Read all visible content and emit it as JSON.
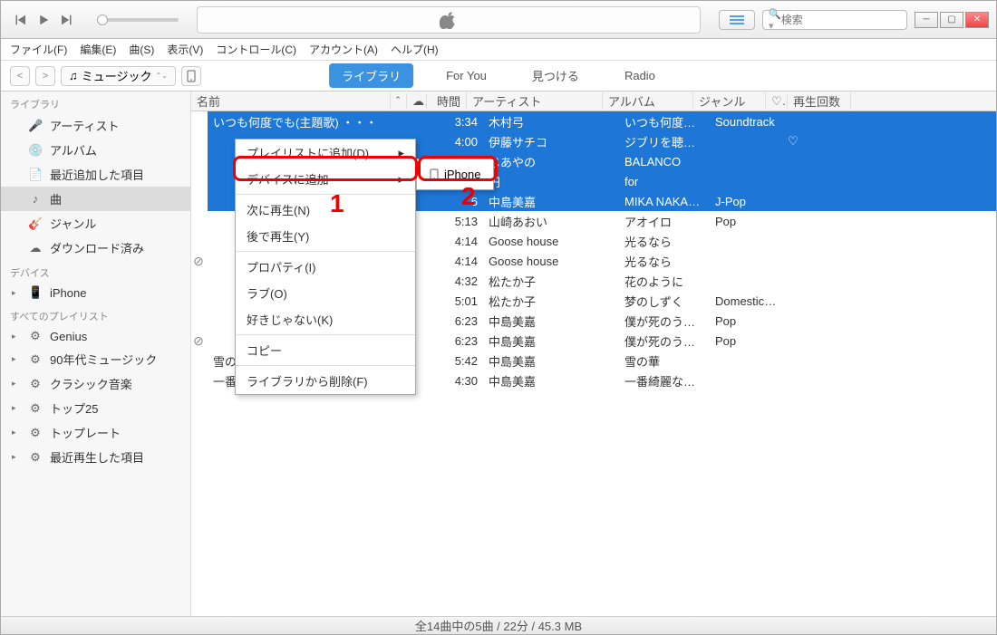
{
  "player": {
    "search_placeholder": "検索"
  },
  "menubar": [
    "ファイル(F)",
    "編集(E)",
    "曲(S)",
    "表示(V)",
    "コントロール(C)",
    "アカウント(A)",
    "ヘルプ(H)"
  ],
  "source_selector": "ミュージック",
  "nav_tabs": [
    {
      "label": "ライブラリ",
      "active": true
    },
    {
      "label": "For You",
      "active": false
    },
    {
      "label": "見つける",
      "active": false
    },
    {
      "label": "Radio",
      "active": false
    }
  ],
  "sidebar": {
    "library_header": "ライブラリ",
    "library_items": [
      {
        "icon": "mic",
        "label": "アーティスト"
      },
      {
        "icon": "disc",
        "label": "アルバム"
      },
      {
        "icon": "list",
        "label": "最近追加した項目"
      },
      {
        "icon": "note",
        "label": "曲",
        "selected": true
      },
      {
        "icon": "genre",
        "label": "ジャンル"
      },
      {
        "icon": "cloud",
        "label": "ダウンロード済み"
      }
    ],
    "device_header": "デバイス",
    "device_items": [
      {
        "icon": "phone",
        "label": "iPhone"
      }
    ],
    "playlist_header": "すべてのプレイリスト",
    "playlist_items": [
      {
        "icon": "gear",
        "label": "Genius"
      },
      {
        "icon": "gear",
        "label": "90年代ミュージック"
      },
      {
        "icon": "gear",
        "label": "クラシック音楽"
      },
      {
        "icon": "gear",
        "label": "トップ25"
      },
      {
        "icon": "gear",
        "label": "トップレート"
      },
      {
        "icon": "gear",
        "label": "最近再生した項目"
      }
    ]
  },
  "columns": {
    "name": "名前",
    "cloud": "",
    "time": "時間",
    "artist": "アーティスト",
    "album": "アルバム",
    "genre": "ジャンル",
    "heart": "♡",
    "plays": "再生回数"
  },
  "rows": [
    {
      "selected": true,
      "warn": false,
      "name": "いつも何度でも(主題歌) ・・・",
      "time": "3:34",
      "artist": "木村弓",
      "album": "いつも何度でも",
      "genre": "Soundtrack",
      "heart": ""
    },
    {
      "selected": true,
      "warn": false,
      "name": "",
      "time": "4:00",
      "artist": "伊藤サチコ",
      "album": "ジブリを聴きなが...",
      "genre": "",
      "heart": "♡"
    },
    {
      "selected": true,
      "warn": false,
      "name": "",
      "time": "",
      "artist": "じあやの",
      "album": "BALANCO",
      "genre": "",
      "heart": ""
    },
    {
      "selected": true,
      "warn": false,
      "name": "",
      "time": "",
      "artist": "円",
      "album": "for",
      "genre": "",
      "heart": ""
    },
    {
      "selected": true,
      "warn": false,
      "name": "",
      "time": "6",
      "artist": "中島美嘉",
      "album": "MIKA NAKASHIMA...",
      "genre": "J-Pop",
      "heart": ""
    },
    {
      "selected": false,
      "warn": false,
      "name": "",
      "time": "5:13",
      "artist": "山崎あおい",
      "album": "アオイロ",
      "genre": "Pop",
      "heart": ""
    },
    {
      "selected": false,
      "warn": false,
      "name": "",
      "time": "4:14",
      "artist": "Goose house",
      "album": "光るなら",
      "genre": "",
      "heart": ""
    },
    {
      "selected": false,
      "warn": true,
      "name": "",
      "time": "4:14",
      "artist": "Goose house",
      "album": "光るなら",
      "genre": "",
      "heart": ""
    },
    {
      "selected": false,
      "warn": false,
      "name": "",
      "time": "4:32",
      "artist": "松たか子",
      "album": "花のように",
      "genre": "",
      "heart": ""
    },
    {
      "selected": false,
      "warn": false,
      "name": "",
      "time": "5:01",
      "artist": "松たか子",
      "album": "梦のしずく",
      "genre": "Domestic(J...",
      "heart": ""
    },
    {
      "selected": false,
      "warn": false,
      "name": "",
      "time": "6:23",
      "artist": "中島美嘉",
      "album": "僕が死のうと思っ...",
      "genre": "Pop",
      "heart": ""
    },
    {
      "selected": false,
      "warn": true,
      "name": "",
      "time": "6:23",
      "artist": "中島美嘉",
      "album": "僕が死のうと思っ...",
      "genre": "Pop",
      "heart": ""
    },
    {
      "selected": false,
      "warn": false,
      "name": "雪の華",
      "time": "5:42",
      "artist": "中島美嘉",
      "album": "雪の華",
      "genre": "",
      "heart": ""
    },
    {
      "selected": false,
      "warn": false,
      "name": "一番綺麗な私を",
      "time": "4:30",
      "artist": "中島美嘉",
      "album": "一番綺麗な私を",
      "genre": "",
      "heart": ""
    }
  ],
  "context_menu": {
    "items": [
      {
        "label": "プレイリストに追加(D)",
        "arrow": true
      },
      {
        "label": "デバイスに追加",
        "arrow": true,
        "highlight": true
      },
      {
        "sep": true
      },
      {
        "label": "次に再生(N)"
      },
      {
        "label": "後で再生(Y)"
      },
      {
        "sep": true
      },
      {
        "label": "プロパティ(I)"
      },
      {
        "label": "ラブ(O)"
      },
      {
        "label": "好きじゃない(K)"
      },
      {
        "sep": true
      },
      {
        "label": "コピー"
      },
      {
        "sep": true
      },
      {
        "label": "ライブラリから削除(F)"
      }
    ],
    "submenu_label": "iPhone"
  },
  "annotations": {
    "n1": "1",
    "n2": "2"
  },
  "status": "全14曲中の5曲 / 22分 / 45.3 MB"
}
